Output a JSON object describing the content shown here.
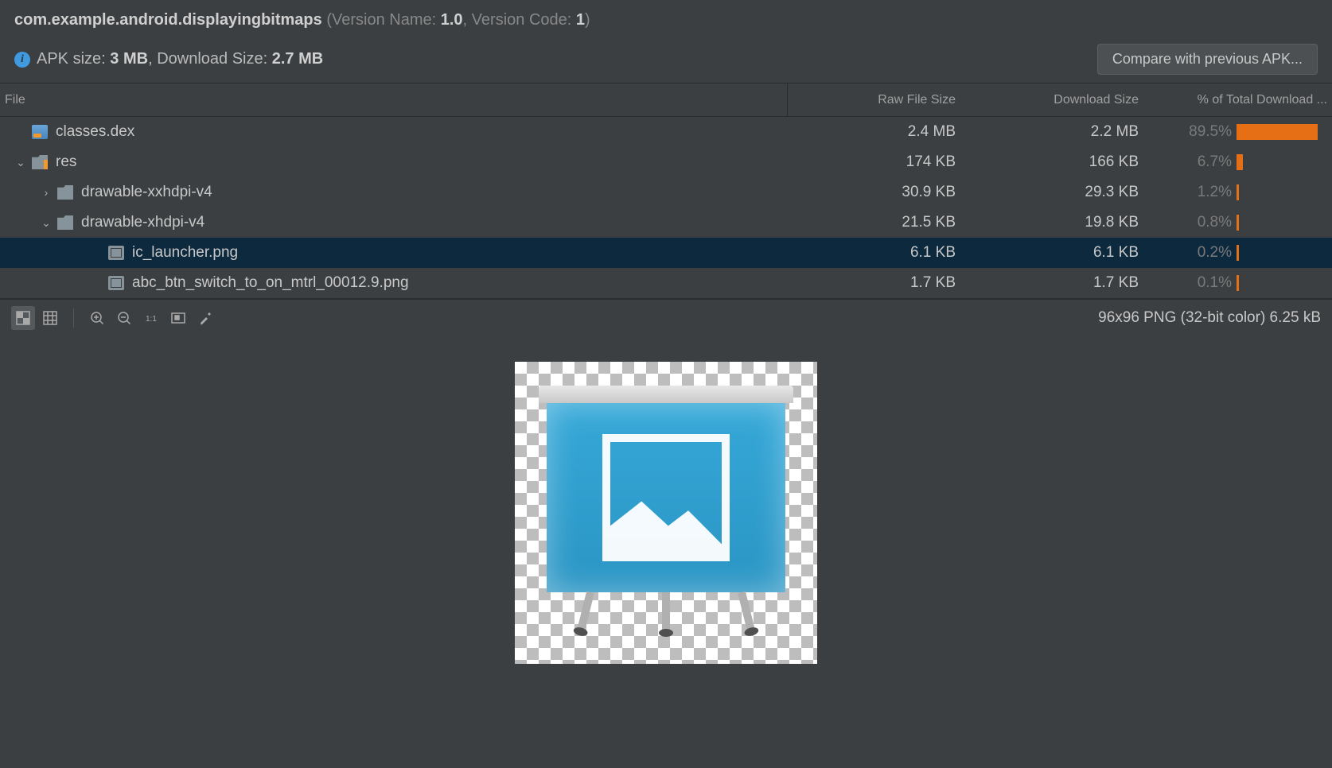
{
  "header": {
    "package": "com.example.android.displayingbitmaps",
    "version_name_label": "Version Name:",
    "version_name": "1.0",
    "version_code_label": "Version Code:",
    "version_code": "1",
    "apk_size_label": "APK size:",
    "apk_size": "3 MB",
    "dl_size_label": "Download Size:",
    "dl_size": "2.7 MB",
    "compare_btn": "Compare with previous APK..."
  },
  "columns": {
    "file": "File",
    "raw": "Raw File Size",
    "download": "Download Size",
    "pct": "% of Total Download ..."
  },
  "rows": [
    {
      "indent": 0,
      "arrow": "none",
      "icon": "dex",
      "name": "classes.dex",
      "raw": "2.4 MB",
      "dl": "2.2 MB",
      "pct": "89.5%",
      "bar": 89.5,
      "selected": false
    },
    {
      "indent": 0,
      "arrow": "down",
      "icon": "folder-special",
      "name": "res",
      "raw": "174 KB",
      "dl": "166 KB",
      "pct": "6.7%",
      "bar": 6.7,
      "selected": false
    },
    {
      "indent": 1,
      "arrow": "right",
      "icon": "folder",
      "name": "drawable-xxhdpi-v4",
      "raw": "30.9 KB",
      "dl": "29.3 KB",
      "pct": "1.2%",
      "bar": 1.2,
      "selected": false
    },
    {
      "indent": 1,
      "arrow": "down",
      "icon": "folder",
      "name": "drawable-xhdpi-v4",
      "raw": "21.5 KB",
      "dl": "19.8 KB",
      "pct": "0.8%",
      "bar": 0.8,
      "selected": false
    },
    {
      "indent": 2,
      "arrow": "none",
      "icon": "img",
      "name": "ic_launcher.png",
      "raw": "6.1 KB",
      "dl": "6.1 KB",
      "pct": "0.2%",
      "bar": 0.2,
      "selected": true
    },
    {
      "indent": 2,
      "arrow": "none",
      "icon": "img",
      "name": "abc_btn_switch_to_on_mtrl_00012.9.png",
      "raw": "1.7 KB",
      "dl": "1.7 KB",
      "pct": "0.1%",
      "bar": 0.1,
      "selected": false
    }
  ],
  "preview": {
    "info": "96x96 PNG (32-bit color) 6.25 kB"
  }
}
